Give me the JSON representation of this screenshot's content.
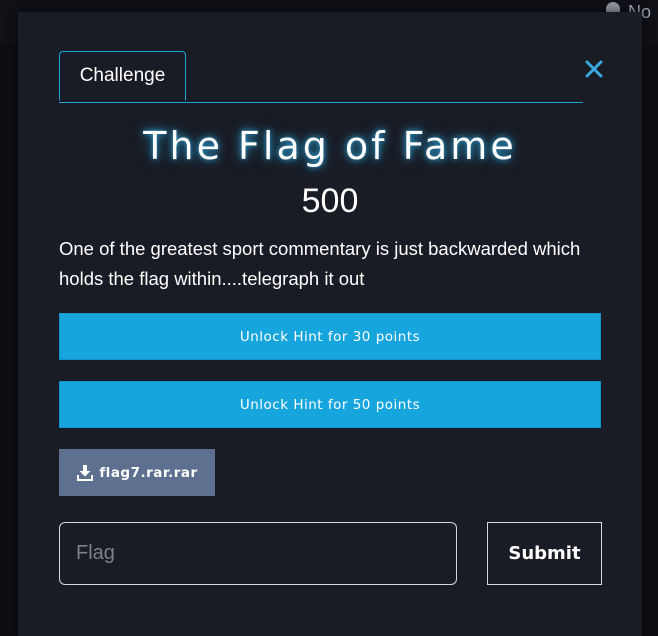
{
  "background": {
    "user_menu_label": "No"
  },
  "modal": {
    "tab_label": "Challenge",
    "title": "The Flag of Fame",
    "points": "500",
    "description": "One of the greatest sport commentary is just backwarded which holds the flag within....telegraph it out",
    "hints": [
      {
        "label": "Unlock Hint for 30 points"
      },
      {
        "label": "Unlock Hint for 50 points"
      }
    ],
    "file": {
      "name": "flag7.rar.rar",
      "icon": "download-icon"
    },
    "flag_input": {
      "placeholder": "Flag",
      "value": ""
    },
    "submit_label": "Submit",
    "close_icon": "close-icon"
  },
  "colors": {
    "accent": "#17a5de",
    "modal_bg": "#191c24",
    "file_button": "#5e7090",
    "title_glow": "#2a9fd6"
  }
}
